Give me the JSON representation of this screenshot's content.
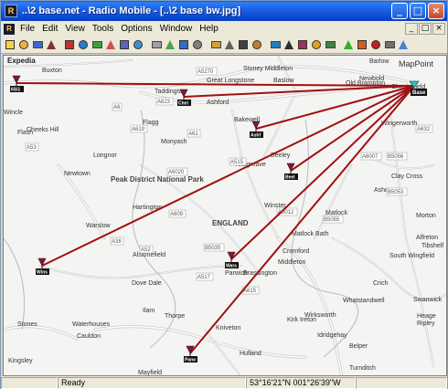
{
  "window": {
    "title": "..\\2 base.net - Radio Mobile - [..\\2 base bw.jpg]",
    "controls": [
      "_",
      "□",
      "×"
    ]
  },
  "menu": [
    {
      "label": "File"
    },
    {
      "label": "Edit"
    },
    {
      "label": "View"
    },
    {
      "label": "Tools"
    },
    {
      "label": "Options"
    },
    {
      "label": "Window"
    },
    {
      "label": "Help"
    }
  ],
  "toolbar_icons": [
    "new-icon",
    "open-icon",
    "save-icon",
    "network-properties-icon",
    "radio-link-icon",
    "world-icon",
    "coverage-icon",
    "color-icon",
    "visual-icon",
    "rotate-icon",
    "properties-icon",
    "map-icon",
    "merge-icon",
    "erase-icon",
    "copy-icon",
    "print-icon",
    "grid-icon",
    "picture-icon",
    "overlay-icon",
    "text-icon",
    "landmark-icon",
    "colors-icon",
    "elevation-icon",
    "green-icon",
    "gps-icon",
    "cross-icon",
    "gear-icon",
    "help-icon"
  ],
  "map": {
    "corner_labels": {
      "top_left": "Expedia",
      "top_right": "MapPoint"
    },
    "big_labels": [
      "Peak District National Park",
      "ENGLAND"
    ],
    "towns": [
      "Buxton",
      "Chesterfield",
      "Great Longstone",
      "Baslow",
      "Old Brampton",
      "Newbold",
      "Stoney Middleton",
      "Barlow",
      "Taddington",
      "Ashford",
      "Bakewell",
      "Cheeks Hill",
      "Flash",
      "Flagg",
      "Monyash",
      "Wingerworth",
      "Longnor",
      "Beeley",
      "Youlgreave",
      "Newtown",
      "Clay Cross",
      "Ashover",
      "Hartington",
      "Winster",
      "Morton",
      "Warslow",
      "Matlock",
      "Matlock Bath",
      "Tibshelf",
      "Alstonefield",
      "Parwich",
      "Brassington",
      "Cromford",
      "South Wingfield",
      "Alfreton",
      "Crich",
      "Dove Dale",
      "Ilam",
      "Whatstandwell",
      "Swanwick",
      "Thorpe",
      "Wirksworth",
      "Ripley",
      "Waterhouses",
      "Cauldon",
      "Kniveton",
      "Kirk Ireton",
      "Heage",
      "Belper",
      "Hulland",
      "Turnditch",
      "Mayfield",
      "Kilburn",
      "Stones",
      "Kingsley",
      "Middleton",
      "Wincle",
      "Idridgehay"
    ],
    "roads": [
      "A6",
      "A623",
      "A619",
      "A61",
      "A515",
      "A5012",
      "A6020",
      "B5056",
      "A52",
      "A517",
      "A615",
      "A38",
      "B5055",
      "A632",
      "A609",
      "A6007",
      "B5053",
      "A53",
      "A5270",
      "B5035"
    ],
    "sites": [
      {
        "label": "Base",
        "role": "central"
      },
      {
        "label": "6Si1",
        "role": "remote"
      },
      {
        "label": "Chelmorton",
        "role": "remote"
      },
      {
        "label": "Ashford",
        "role": "remote"
      },
      {
        "label": "Beeley",
        "role": "remote"
      },
      {
        "label": "Winster",
        "role": "remote"
      },
      {
        "label": "Warslow",
        "role": "remote"
      },
      {
        "label": "Parwich",
        "role": "remote"
      },
      {
        "label": "Ashbourne",
        "role": "remote"
      }
    ],
    "link_color": "#a01010",
    "antenna_color": "#7a1a3a",
    "base_color": "#30c0c8"
  },
  "status": {
    "mode": "",
    "state": "Ready",
    "coords": "53°16'21\"N 001°26'39\"W",
    "extra": ""
  }
}
